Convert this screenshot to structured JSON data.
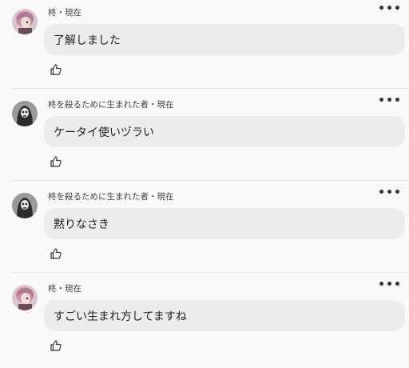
{
  "comments": [
    {
      "meta": "柊・現在",
      "text": "了解しました",
      "avatar": "pink-hair-character-avatar",
      "more_label": "•••",
      "like_icon": "thumbs-up-icon"
    },
    {
      "meta": "柊を殺るために生まれた者・現在",
      "text": "ケータイ使いヅラい",
      "avatar": "skull-reaper-avatar",
      "more_label": "•••",
      "like_icon": "thumbs-up-icon"
    },
    {
      "meta": "柊を殺るために生まれた者・現在",
      "text": "黙りなさき",
      "avatar": "skull-reaper-avatar",
      "more_label": "•••",
      "like_icon": "thumbs-up-icon"
    },
    {
      "meta": "柊・現在",
      "text": "すごい生まれ方してますね",
      "avatar": "pink-hair-character-avatar",
      "more_label": "•••",
      "like_icon": "thumbs-up-icon"
    }
  ]
}
